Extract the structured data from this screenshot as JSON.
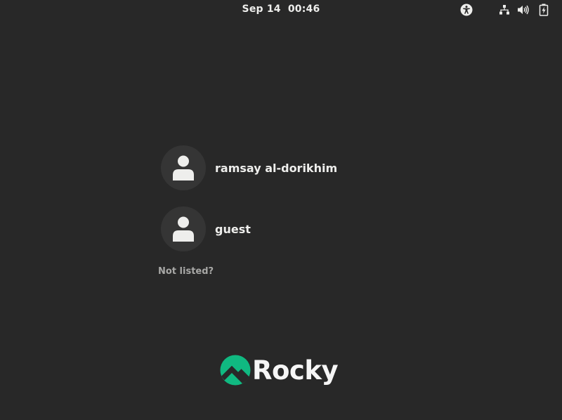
{
  "topbar": {
    "date": "Sep 14",
    "time": "00:46",
    "icons": [
      "accessibility-icon",
      "network-wired-icon",
      "volume-icon",
      "battery-charging-icon"
    ]
  },
  "users": [
    {
      "name": "ramsay al-dorikhim",
      "avatar_icon": "person-icon"
    },
    {
      "name": "guest",
      "avatar_icon": "person-icon"
    }
  ],
  "not_listed_label": "Not listed?",
  "logo": {
    "text": "Rocky",
    "accent_color": "#10b981"
  },
  "colors": {
    "background": "#282828",
    "avatar_bg": "#353535",
    "text": "#eeeeec",
    "muted_text": "#a8a8a6"
  }
}
